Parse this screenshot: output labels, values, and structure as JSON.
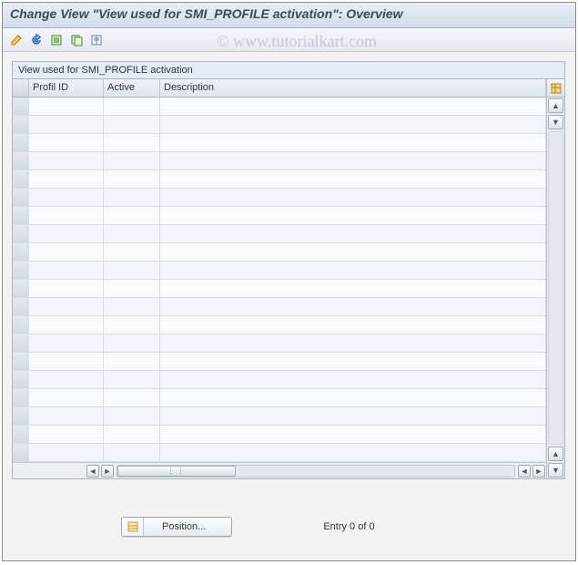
{
  "title": "Change View \"View used for SMI_PROFILE activation\": Overview",
  "watermark": "© www.tutorialkart.com",
  "panel": {
    "caption": "View used for SMI_PROFILE activation"
  },
  "columns": {
    "profil_id": "Profil ID",
    "active": "Active",
    "description": "Description"
  },
  "footer": {
    "position_label": "Position...",
    "entry_text": "Entry 0 of 0"
  },
  "toolbar": {
    "icons": [
      "edit-pencil",
      "undo-arrow",
      "new-entries",
      "copy-entry",
      "delete-entry"
    ]
  }
}
